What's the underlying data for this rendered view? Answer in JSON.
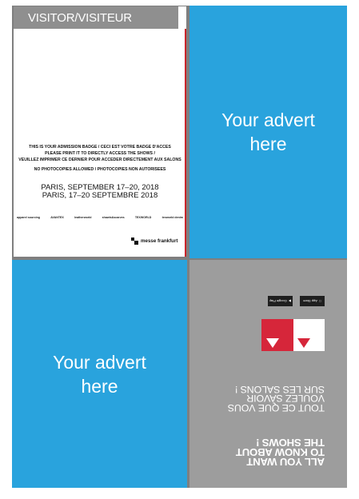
{
  "badge": {
    "title_en": "VISITOR",
    "title_sep": "/",
    "title_fr": "VISITEUR",
    "line1": "THIS IS YOUR ADMISSION BADGE / CECI EST VOTRE BADGE D'ACCES",
    "line2": "PLEASE PRINT IT TO DIRECTLY ACCESS THE SHOWS /",
    "line3": "VEUILLEZ IMPRIMER CE DERNIER POUR ACCEDER DIRECTEMENT AUX SALONS",
    "line4": "NO PHOTOCOPIES ALLOWED / PHOTOCOPIES NON AUTORISEES",
    "date_en": "PARIS, SEPTEMBER 17–20, 2018",
    "date_fr": "PARIS, 17–20 SEPTEMBRE 2018",
    "logos": [
      "apparel sourcing",
      "AVANTEX",
      "leatherworld",
      "shawls&scarves",
      "TEXWORLD",
      "texworld denim"
    ],
    "brand": "messe frankfurt"
  },
  "advert_top": {
    "line1": "Your advert",
    "line2": "here"
  },
  "advert_bottom": {
    "line1": "Your advert",
    "line2": "here"
  },
  "promo": {
    "heading": [
      "ALL YOU WANT",
      "TO KNOW ABOUT",
      "THE SHOWS !"
    ],
    "subheading": [
      "TOUT CE QUE VOUS",
      "VOULEZ SAVOIR",
      "SUR LES SALONS !"
    ],
    "ios_label": "App Store",
    "android_label": "Google Play"
  },
  "colors": {
    "advert_blue": "#29a3dd",
    "panel_grey": "#9d9d9d",
    "accent_red": "#d6263a"
  }
}
